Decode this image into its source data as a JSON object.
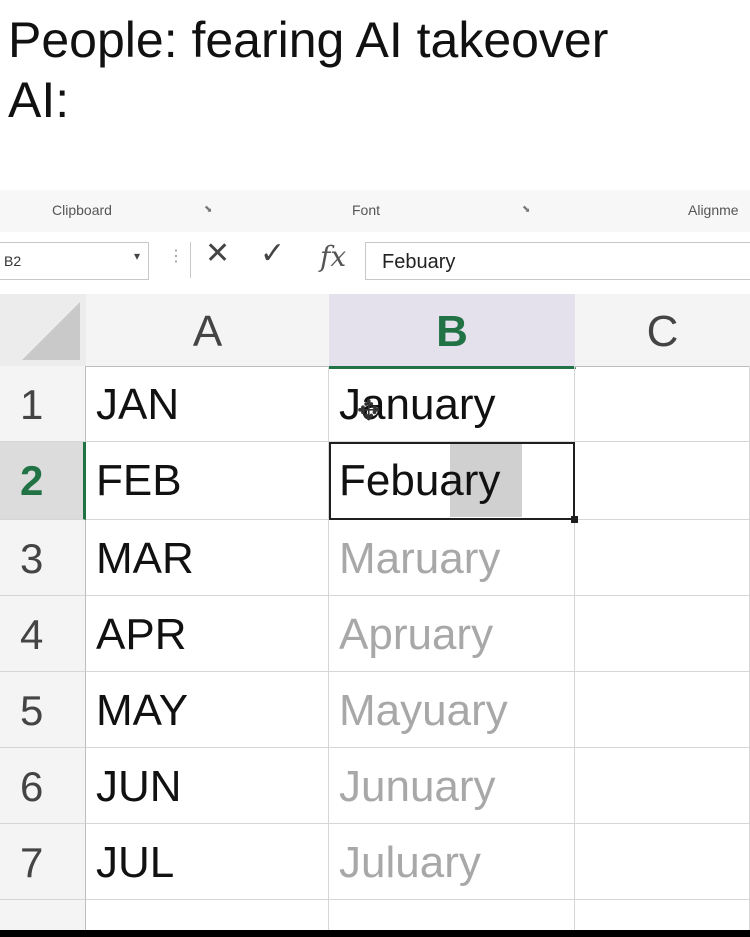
{
  "caption": {
    "line1": "People: fearing AI takeover",
    "line2": "AI:"
  },
  "ribbon": {
    "groups": [
      "Clipboard",
      "Font",
      "Alignme"
    ]
  },
  "formula_bar": {
    "name_box": "B2",
    "cancel_icon": "✕",
    "enter_icon": "✓",
    "fx_label": "fx",
    "value": "Febuary"
  },
  "sheet": {
    "columns": [
      "A",
      "B",
      "C"
    ],
    "selected_column": "B",
    "selected_row": "2",
    "rows": [
      {
        "num": "1",
        "a": "JAN",
        "b": "January",
        "b_filled": false
      },
      {
        "num": "2",
        "a": "FEB",
        "b": "Febuary",
        "b_filled": false
      },
      {
        "num": "3",
        "a": "MAR",
        "b": "Maruary",
        "b_filled": true
      },
      {
        "num": "4",
        "a": "APR",
        "b": "Apruary",
        "b_filled": true
      },
      {
        "num": "5",
        "a": "MAY",
        "b": "Mayuary",
        "b_filled": true
      },
      {
        "num": "6",
        "a": "JUN",
        "b": "Junuary",
        "b_filled": true
      },
      {
        "num": "7",
        "a": "JUL",
        "b": "Juluary",
        "b_filled": true
      }
    ]
  },
  "colors": {
    "excel_green": "#217346",
    "autofill_text": "#a8a8a8"
  }
}
